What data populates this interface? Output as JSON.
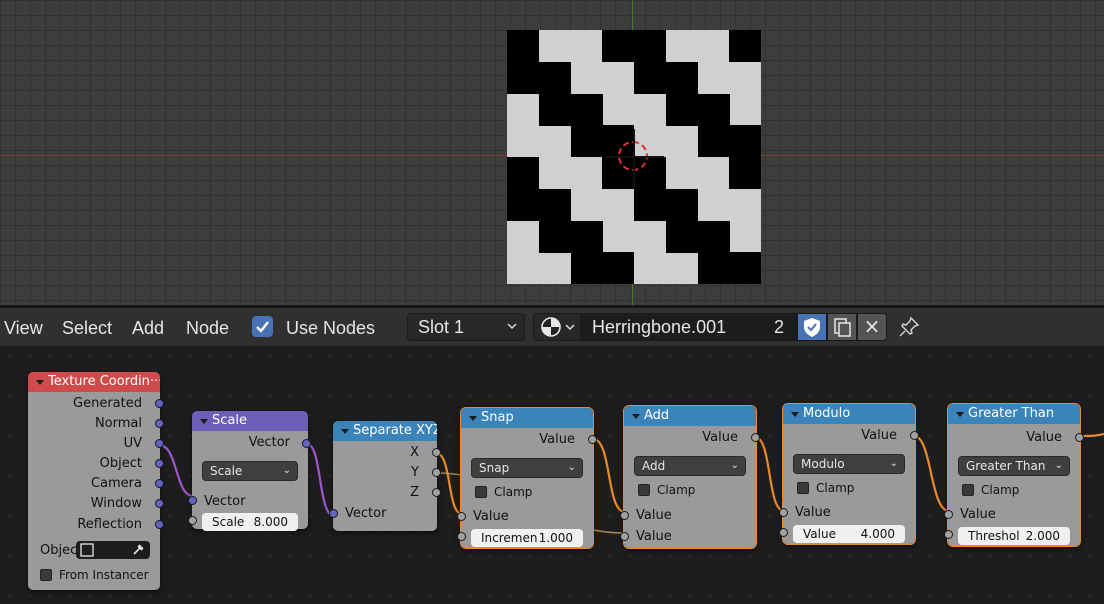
{
  "menu": {
    "view": "View",
    "select": "Select",
    "add": "Add",
    "node": "Node"
  },
  "use_nodes": {
    "label": "Use Nodes",
    "checked": true
  },
  "slot": {
    "value": "Slot 1"
  },
  "material": {
    "name": "Herringbone.001",
    "users": "2",
    "unlink": "×"
  },
  "colors": {
    "accent": "#4772b3",
    "selection": "#e8892c",
    "texcoord_header": "#cf4b4b",
    "vector_header": "#6b5fb8",
    "converter_header": "#3a84b9"
  },
  "icons": [
    "checkmark-icon",
    "chevron-down-icon",
    "material-sphere-icon",
    "fake-user-shield-icon",
    "copy-icon",
    "close-icon",
    "pin-icon",
    "eyedropper-icon",
    "object-icon"
  ],
  "nodes": {
    "texcoord": {
      "title": "Texture Coordin···",
      "outputs": [
        "Generated",
        "Normal",
        "UV",
        "Object",
        "Camera",
        "Window",
        "Reflection"
      ],
      "object_label": "Objec",
      "from_instancer": "From Instancer"
    },
    "scale": {
      "title": "Scale",
      "output": "Vector",
      "op": "Scale",
      "input": "Vector",
      "scale_label": "Scale",
      "scale_value": "8.000"
    },
    "separate": {
      "title": "Separate XYZ",
      "outputs": [
        "X",
        "Y",
        "Z"
      ],
      "input": "Vector"
    },
    "snap": {
      "title": "Snap",
      "output": "Value",
      "op": "Snap",
      "clamp": "Clamp",
      "input": "Value",
      "inc_label": "Incremen",
      "inc_value": "1.000"
    },
    "add": {
      "title": "Add",
      "output": "Value",
      "op": "Add",
      "clamp": "Clamp",
      "input1": "Value",
      "input2": "Value"
    },
    "modulo": {
      "title": "Modulo",
      "output": "Value",
      "op": "Modulo",
      "clamp": "Clamp",
      "input": "Value",
      "val_label": "Value",
      "val_value": "4.000"
    },
    "greater": {
      "title": "Greater Than",
      "output": "Value",
      "op": "Greater Than",
      "clamp": "Clamp",
      "input": "Value",
      "thr_label": "Threshol",
      "thr_value": "2.000"
    }
  }
}
